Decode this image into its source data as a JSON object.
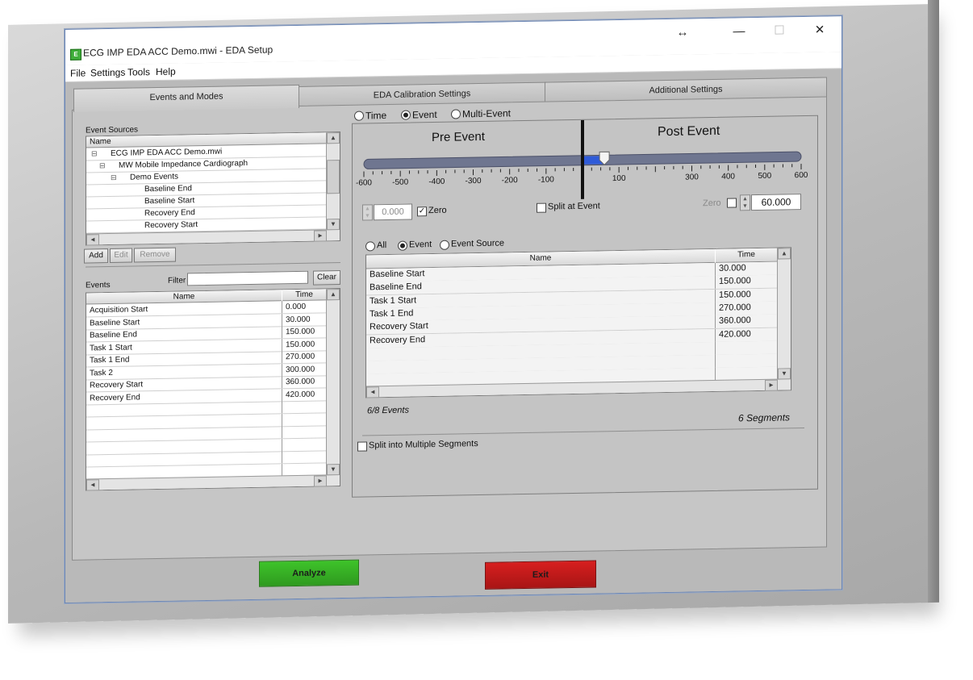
{
  "window": {
    "title": "ECG IMP EDA ACC Demo.mwi - EDA Setup",
    "controls": {
      "resize": "↔",
      "minimize": "—",
      "maximize": "☐",
      "close": "✕"
    }
  },
  "menu": [
    "File",
    "Settings",
    "Tools",
    "Help"
  ],
  "tabs": [
    {
      "label": "Events and Modes",
      "active": true
    },
    {
      "label": "EDA Calibration Settings",
      "active": false
    },
    {
      "label": "Additional Settings",
      "active": false
    }
  ],
  "event_sources": {
    "label": "Event Sources",
    "column": "Name",
    "items": [
      {
        "text": "ECG IMP EDA ACC Demo.mwi",
        "expander": "⊟"
      },
      {
        "text": "MW Mobile Impedance Cardiograph",
        "expander": "⊟"
      },
      {
        "text": "Demo Events",
        "expander": "⊟"
      },
      {
        "text": "Baseline End",
        "expander": ""
      },
      {
        "text": "Baseline Start",
        "expander": ""
      },
      {
        "text": "Recovery End",
        "expander": ""
      },
      {
        "text": "Recovery Start",
        "expander": ""
      }
    ],
    "buttons": {
      "add": "Add",
      "edit": "Edit",
      "remove": "Remove"
    }
  },
  "events": {
    "label": "Events",
    "filter_label": "Filter",
    "filter_value": "",
    "clear": "Clear",
    "columns": {
      "name": "Name",
      "time": "Time"
    },
    "rows": [
      {
        "name": "Acquisition Start",
        "time": "0.000"
      },
      {
        "name": "Baseline Start",
        "time": "30.000"
      },
      {
        "name": "Baseline End",
        "time": "150.000"
      },
      {
        "name": "Task 1 Start",
        "time": "150.000"
      },
      {
        "name": "Task 1 End",
        "time": "270.000"
      },
      {
        "name": "Task 2",
        "time": "300.000"
      },
      {
        "name": "Recovery Start",
        "time": "360.000"
      },
      {
        "name": "Recovery End",
        "time": "420.000"
      }
    ]
  },
  "mode": {
    "options": [
      "Time",
      "Event",
      "Multi-Event"
    ],
    "selected": "Event"
  },
  "slider": {
    "pre_label": "Pre Event",
    "post_label": "Post Event",
    "min": -600,
    "max": 600,
    "value": 60,
    "ticks": [
      "-600",
      "-500",
      "-400",
      "-300",
      "-200",
      "-100",
      "100",
      "300",
      "400",
      "500",
      "600"
    ],
    "tick_values": [
      -600,
      -500,
      -400,
      -300,
      -200,
      -100,
      100,
      300,
      400,
      500,
      600
    ],
    "accent": "#2f5bd8"
  },
  "pre_field": {
    "value": "0.000",
    "zero_label": "Zero",
    "zero_checked": true
  },
  "split_at_event": {
    "label": "Split at Event",
    "checked": false
  },
  "post_field": {
    "value": "60.000",
    "zero_label": "Zero",
    "zero_checked": false
  },
  "filter_mode": {
    "options": [
      "All",
      "Event",
      "Event Source"
    ],
    "selected": "Event"
  },
  "selected_events": {
    "columns": {
      "name": "Name",
      "time": "Time"
    },
    "rows": [
      {
        "name": "Baseline Start",
        "time": "30.000"
      },
      {
        "name": "Baseline End",
        "time": "150.000"
      },
      {
        "name": "Task 1 Start",
        "time": "150.000"
      },
      {
        "name": "Task 1 End",
        "time": "270.000"
      },
      {
        "name": "Recovery Start",
        "time": "360.000"
      },
      {
        "name": "Recovery End",
        "time": "420.000"
      }
    ],
    "count_text": "6/8 Events",
    "segments_text": "6 Segments"
  },
  "split_multiple": {
    "label": "Split into Multiple Segments",
    "checked": false
  },
  "actions": {
    "analyze": {
      "label": "Analyze",
      "color": "#3ec32a"
    },
    "exit": {
      "label": "Exit",
      "color": "#d71f1f"
    }
  }
}
